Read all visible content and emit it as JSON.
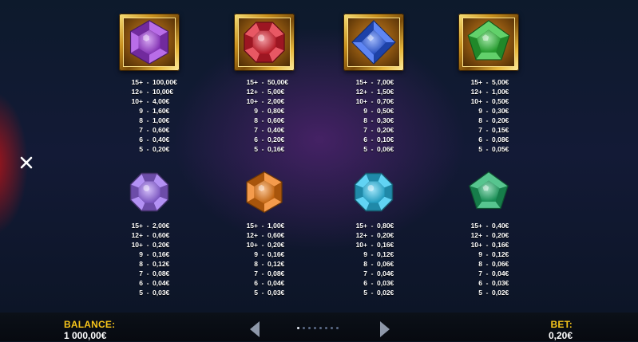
{
  "framed_symbols": [
    {
      "icon": "purple-hexagon-gem-icon",
      "color": "#a23ce0",
      "pays": [
        {
          "count": "15+",
          "amount": "100,00€"
        },
        {
          "count": "12+",
          "amount": "10,00€"
        },
        {
          "count": "10+",
          "amount": "4,00€"
        },
        {
          "count": "9",
          "amount": "1,60€"
        },
        {
          "count": "8",
          "amount": "1,00€"
        },
        {
          "count": "7",
          "amount": "0,60€"
        },
        {
          "count": "6",
          "amount": "0,40€"
        },
        {
          "count": "5",
          "amount": "0,20€"
        }
      ]
    },
    {
      "icon": "red-octagon-gem-icon",
      "color": "#e02030",
      "pays": [
        {
          "count": "15+",
          "amount": "50,00€"
        },
        {
          "count": "12+",
          "amount": "5,00€"
        },
        {
          "count": "10+",
          "amount": "2,00€"
        },
        {
          "count": "9",
          "amount": "0,80€"
        },
        {
          "count": "8",
          "amount": "0,60€"
        },
        {
          "count": "7",
          "amount": "0,40€"
        },
        {
          "count": "6",
          "amount": "0,20€"
        },
        {
          "count": "5",
          "amount": "0,16€"
        }
      ]
    },
    {
      "icon": "blue-diamond-gem-icon",
      "color": "#2a5ef0",
      "pays": [
        {
          "count": "15+",
          "amount": "7,00€"
        },
        {
          "count": "12+",
          "amount": "1,50€"
        },
        {
          "count": "10+",
          "amount": "0,70€"
        },
        {
          "count": "9",
          "amount": "0,50€"
        },
        {
          "count": "8",
          "amount": "0,30€"
        },
        {
          "count": "7",
          "amount": "0,20€"
        },
        {
          "count": "6",
          "amount": "0,10€"
        },
        {
          "count": "5",
          "amount": "0,06€"
        }
      ]
    },
    {
      "icon": "green-pentagon-gem-icon",
      "color": "#2ec23a",
      "pays": [
        {
          "count": "15+",
          "amount": "5,00€"
        },
        {
          "count": "12+",
          "amount": "1,00€"
        },
        {
          "count": "10+",
          "amount": "0,50€"
        },
        {
          "count": "9",
          "amount": "0,30€"
        },
        {
          "count": "8",
          "amount": "0,20€"
        },
        {
          "count": "7",
          "amount": "0,15€"
        },
        {
          "count": "6",
          "amount": "0,08€"
        },
        {
          "count": "5",
          "amount": "0,05€"
        }
      ]
    }
  ],
  "loose_symbols": [
    {
      "icon": "violet-round-gem-icon",
      "color": "#9a6cf0",
      "pays": [
        {
          "count": "15+",
          "amount": "2,00€"
        },
        {
          "count": "12+",
          "amount": "0,60€"
        },
        {
          "count": "10+",
          "amount": "0,20€"
        },
        {
          "count": "9",
          "amount": "0,16€"
        },
        {
          "count": "8",
          "amount": "0,12€"
        },
        {
          "count": "7",
          "amount": "0,08€"
        },
        {
          "count": "6",
          "amount": "0,04€"
        },
        {
          "count": "5",
          "amount": "0,03€"
        }
      ]
    },
    {
      "icon": "orange-hexagon-gem-icon",
      "color": "#f07a10",
      "pays": [
        {
          "count": "15+",
          "amount": "1,00€"
        },
        {
          "count": "12+",
          "amount": "0,60€"
        },
        {
          "count": "10+",
          "amount": "0,20€"
        },
        {
          "count": "9",
          "amount": "0,16€"
        },
        {
          "count": "8",
          "amount": "0,12€"
        },
        {
          "count": "7",
          "amount": "0,08€"
        },
        {
          "count": "6",
          "amount": "0,04€"
        },
        {
          "count": "5",
          "amount": "0,03€"
        }
      ]
    },
    {
      "icon": "cyan-octagon-gem-icon",
      "color": "#2cc4f0",
      "pays": [
        {
          "count": "15+",
          "amount": "0,80€"
        },
        {
          "count": "12+",
          "amount": "0,20€"
        },
        {
          "count": "10+",
          "amount": "0,16€"
        },
        {
          "count": "9",
          "amount": "0,12€"
        },
        {
          "count": "8",
          "amount": "0,06€"
        },
        {
          "count": "7",
          "amount": "0,04€"
        },
        {
          "count": "6",
          "amount": "0,03€"
        },
        {
          "count": "5",
          "amount": "0,02€"
        }
      ]
    },
    {
      "icon": "emerald-pentagon-gem-icon",
      "color": "#1fb26a",
      "pays": [
        {
          "count": "15+",
          "amount": "0,40€"
        },
        {
          "count": "12+",
          "amount": "0,20€"
        },
        {
          "count": "10+",
          "amount": "0,16€"
        },
        {
          "count": "9",
          "amount": "0,12€"
        },
        {
          "count": "8",
          "amount": "0,06€"
        },
        {
          "count": "7",
          "amount": "0,04€"
        },
        {
          "count": "6",
          "amount": "0,03€"
        },
        {
          "count": "5",
          "amount": "0,02€"
        }
      ]
    }
  ],
  "footer": {
    "balance_label": "BALANCE:",
    "balance_value": "1 000,00€",
    "bet_label": "BET:",
    "bet_value": "0,20€",
    "page_count": 8,
    "current_page": 1
  },
  "controls": {
    "close_icon": "close-icon",
    "prev_icon": "chevron-left-icon",
    "next_icon": "chevron-right-icon"
  },
  "colors": {
    "label_gold": "#f7c51a",
    "text_white": "#ffffff"
  }
}
